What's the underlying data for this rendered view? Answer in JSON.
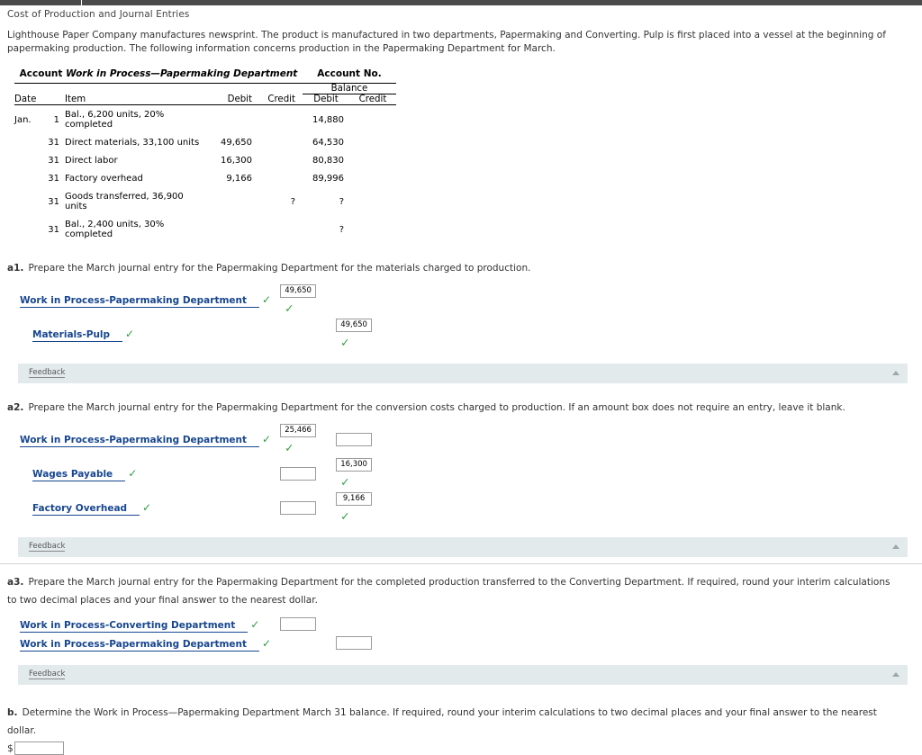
{
  "page": {
    "title": "Cost of Production and Journal Entries",
    "intro": "Lighthouse Paper Company manufactures newsprint. The product is manufactured in two departments, Papermaking and Converting. Pulp is first placed into a vessel at the beginning of papermaking production. The following information concerns production in the Papermaking Department for March."
  },
  "account_table": {
    "account_label": "Account",
    "account_name": "Work in Process—Papermaking Department",
    "account_no_label": "Account No.",
    "balance_header": "Balance",
    "columns": {
      "date": "Date",
      "item": "Item",
      "debit": "Debit",
      "credit": "Credit",
      "bal_debit": "Debit",
      "bal_credit": "Credit"
    },
    "rows": [
      {
        "month": "Jan.",
        "day": "1",
        "item": "Bal., 6,200 units, 20% completed",
        "debit": "",
        "credit": "",
        "bal_debit": "14,880",
        "bal_credit": ""
      },
      {
        "month": "",
        "day": "31",
        "item": "Direct materials, 33,100 units",
        "debit": "49,650",
        "credit": "",
        "bal_debit": "64,530",
        "bal_credit": ""
      },
      {
        "month": "",
        "day": "31",
        "item": "Direct labor",
        "debit": "16,300",
        "credit": "",
        "bal_debit": "80,830",
        "bal_credit": ""
      },
      {
        "month": "",
        "day": "31",
        "item": "Factory overhead",
        "debit": "9,166",
        "credit": "",
        "bal_debit": "89,996",
        "bal_credit": ""
      },
      {
        "month": "",
        "day": "31",
        "item": "Goods transferred, 36,900 units",
        "debit": "",
        "credit": "?",
        "bal_debit": "?",
        "bal_credit": ""
      },
      {
        "month": "",
        "day": "31",
        "item": "Bal., 2,400 units, 30% completed",
        "debit": "",
        "credit": "",
        "bal_debit": "?",
        "bal_credit": ""
      }
    ]
  },
  "a1": {
    "label": "a1.",
    "text": "Prepare the March journal entry for the Papermaking Department for the materials charged to production.",
    "lines": [
      {
        "account": "Work in Process-Papermaking Department",
        "debit": "49,650",
        "credit": ""
      },
      {
        "account": "Materials-Pulp",
        "debit": "",
        "credit": "49,650"
      }
    ],
    "feedback": "Feedback"
  },
  "a2": {
    "label": "a2.",
    "text": "Prepare the March journal entry for the Papermaking Department for the conversion costs charged to production. If an amount box does not require an entry, leave it blank.",
    "lines": [
      {
        "account": "Work in Process-Papermaking Department",
        "debit": "25,466",
        "credit": ""
      },
      {
        "account": "Wages Payable",
        "debit": "",
        "credit": "16,300"
      },
      {
        "account": "Factory Overhead",
        "debit": "",
        "credit": "9,166"
      }
    ],
    "feedback": "Feedback"
  },
  "a3": {
    "label": "a3.",
    "text": "Prepare the March journal entry for the Papermaking Department for the completed production transferred to the Converting Department. If required, round your interim calculations to two decimal places and your final answer to the nearest dollar.",
    "lines": [
      {
        "account": "Work in Process-Converting Department",
        "debit": "",
        "credit": ""
      },
      {
        "account": "Work in Process-Papermaking Department",
        "debit": "",
        "credit": ""
      }
    ],
    "feedback": "Feedback"
  },
  "b": {
    "label": "b.",
    "text": "Determine the Work in Process—Papermaking Department March 31 balance. If required, round your interim calculations to two decimal places and your final answer to the nearest dollar.",
    "currency_symbol": "$",
    "value": ""
  },
  "icons": {
    "check": "✓",
    "caret_up": "caret-up-icon"
  },
  "colors": {
    "link": "#17468f",
    "check": "#2f9e41",
    "feedback_bg": "#e3eaec",
    "topbar": "#4a4a4a"
  }
}
